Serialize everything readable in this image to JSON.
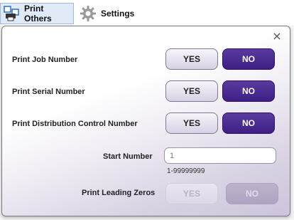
{
  "toolbar": {
    "tabs": [
      {
        "label": "Print Others",
        "icon": "printer-icon",
        "active": true
      },
      {
        "label": "Settings",
        "icon": "gear-icon",
        "active": false
      }
    ]
  },
  "panel": {
    "close_glyph": "×",
    "rows": [
      {
        "label": "Print Job Number",
        "yes": "YES",
        "no": "NO",
        "selected": "NO"
      },
      {
        "label": "Print Serial Number",
        "yes": "YES",
        "no": "NO",
        "selected": "NO"
      },
      {
        "label": "Print Distribution Control Number",
        "yes": "YES",
        "no": "NO",
        "selected": "NO"
      }
    ],
    "start_number": {
      "label": "Start Number",
      "value": "1",
      "range": "1-99999999"
    },
    "leading_zeros": {
      "label": "Print Leading Zeros",
      "yes": "YES",
      "no": "NO",
      "disabled": true
    }
  },
  "colors": {
    "selected_button": "#3e1f86",
    "active_tab_bg": "#dfeaf6"
  }
}
